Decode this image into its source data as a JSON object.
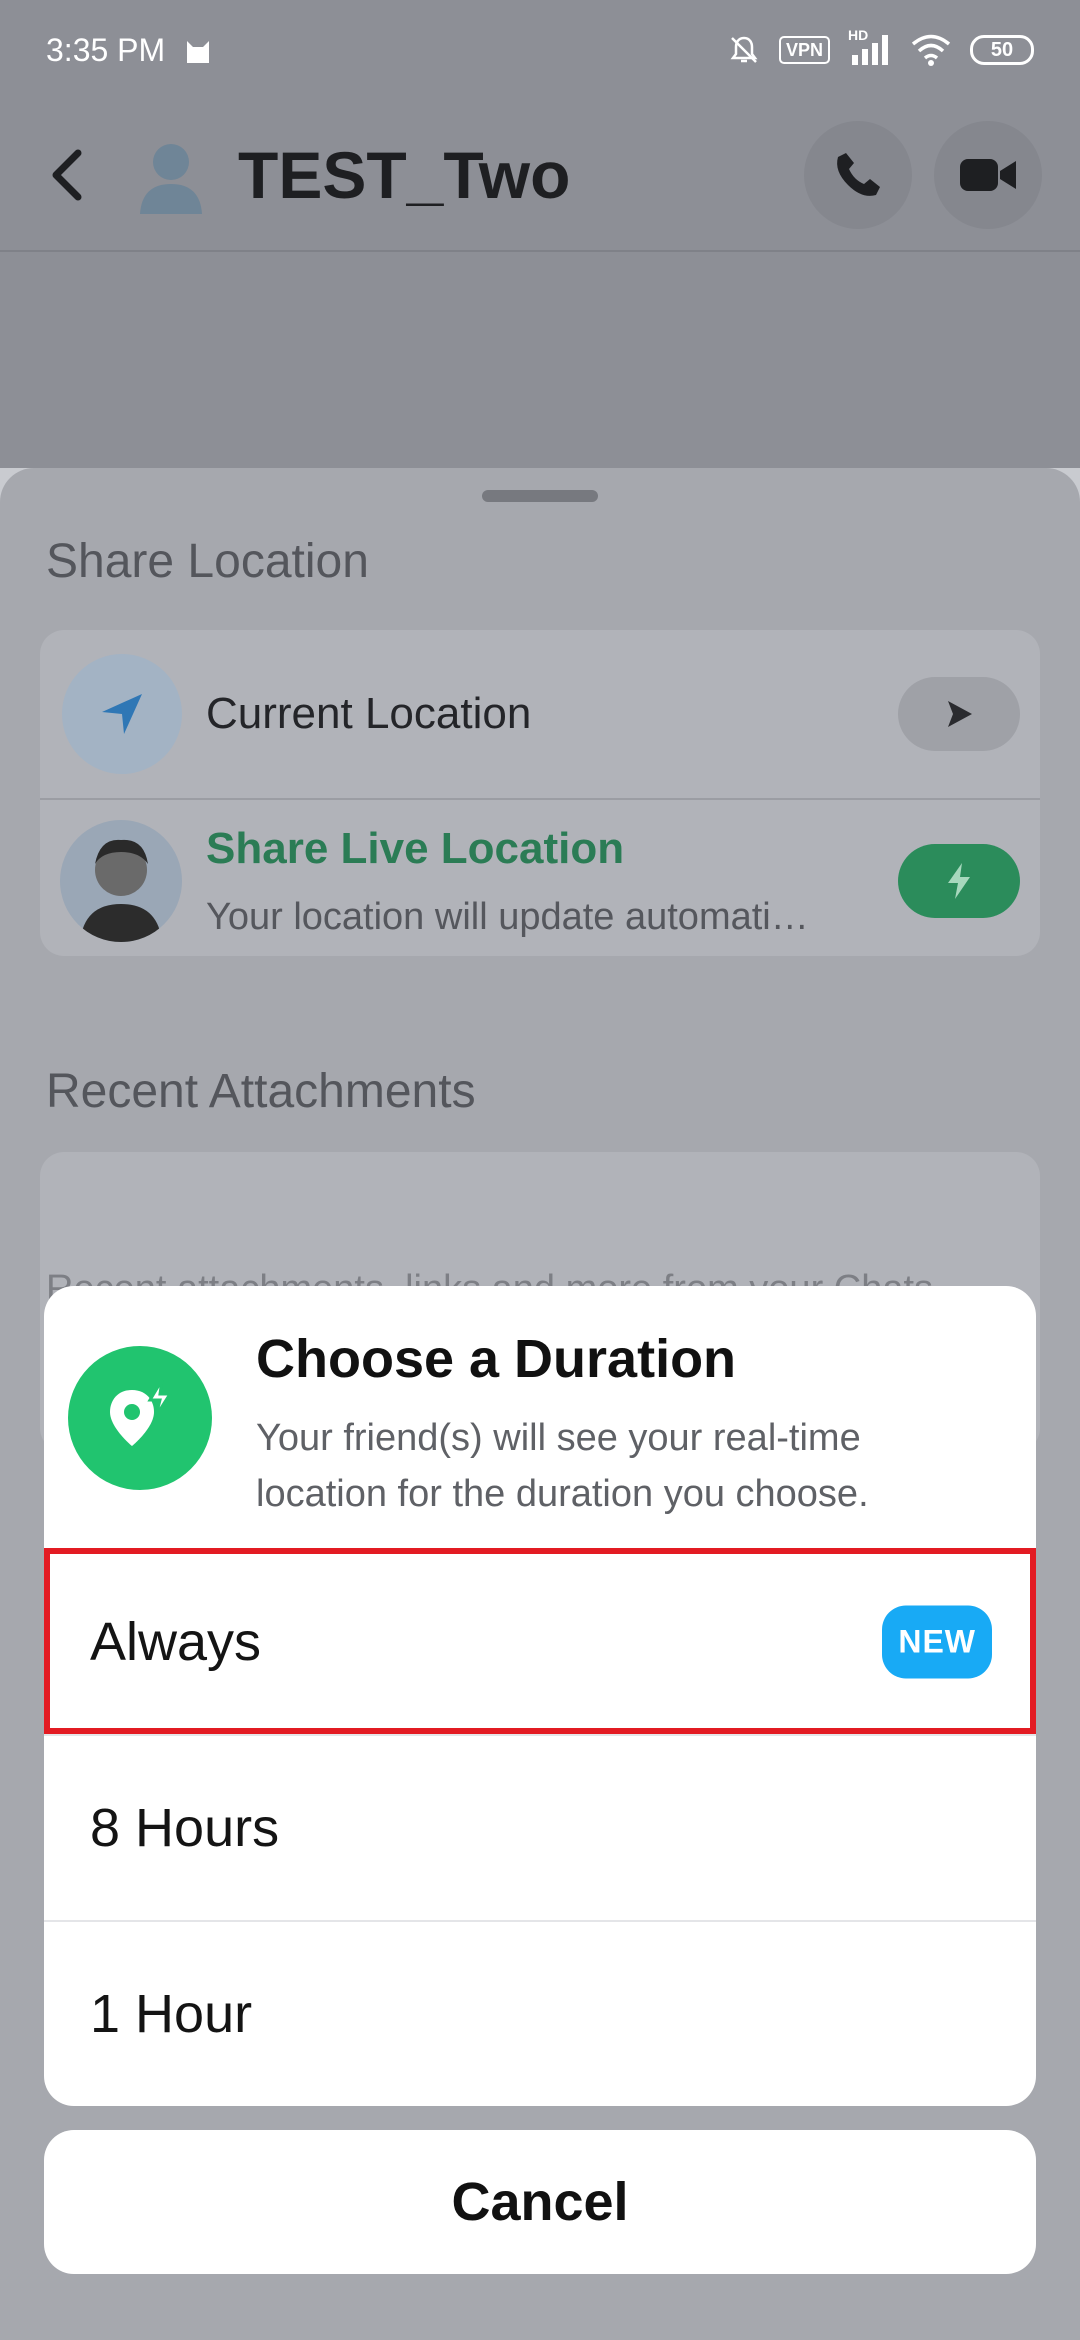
{
  "status_bar": {
    "time": "3:35 PM",
    "vpn": "VPN",
    "hd": "HD",
    "battery": "50",
    "icons": [
      "cat-icon",
      "mute-bell-icon",
      "signal-icon",
      "wifi-icon",
      "battery-icon"
    ]
  },
  "header": {
    "title": "TEST_Two",
    "icons": [
      "back-icon",
      "avatar-icon",
      "phone-icon",
      "video-icon"
    ]
  },
  "sheet": {
    "share_location_title": "Share Location",
    "current_location": {
      "label": "Current Location",
      "icons": [
        "location-arrow-icon",
        "send-icon"
      ]
    },
    "live_location": {
      "title": "Share Live Location",
      "subtitle": "Your location will update automati…",
      "icons": [
        "bitmoji-icon",
        "lightning-icon"
      ]
    },
    "recent_title": "Recent Attachments",
    "recent_hint": "Recent attachments, links and more from your Chats"
  },
  "dialog": {
    "title": "Choose a Duration",
    "subtitle": "Your friend(s) will see your real-time location for the duration you choose.",
    "icon": "live-location-icon",
    "options": [
      {
        "label": "Always",
        "badge": "NEW",
        "selected": true
      },
      {
        "label": "8 Hours"
      },
      {
        "label": "1 Hour"
      }
    ]
  },
  "cancel_label": "Cancel",
  "colors": {
    "accent_green": "#21C46F",
    "badge_blue": "#18AAF5",
    "selection_red": "#E31B23"
  }
}
